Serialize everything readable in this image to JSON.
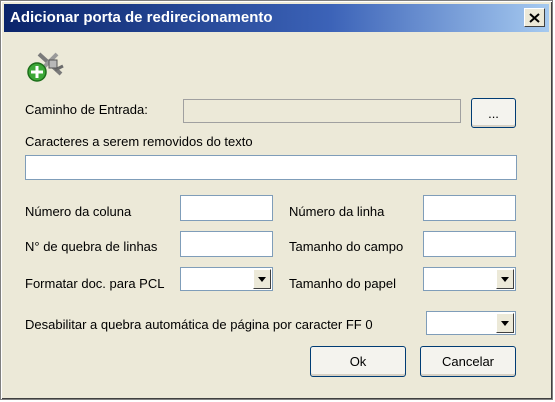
{
  "window": {
    "title": "Adicionar porta de redirecionamento",
    "close_icon": "close-icon"
  },
  "icons": {
    "app": "network-port-add-icon"
  },
  "form": {
    "input_path": {
      "label": "Caminho de Entrada:",
      "value": "",
      "browse_label": "..."
    },
    "chars_remove": {
      "label": "Caracteres a serem removidos do texto",
      "value": ""
    },
    "column_number": {
      "label": "Número da coluna",
      "value": ""
    },
    "line_number": {
      "label": "Número da linha",
      "value": ""
    },
    "line_break_count": {
      "label": "N° de quebra de linhas",
      "value": ""
    },
    "field_size": {
      "label": "Tamanho do campo",
      "value": ""
    },
    "format_pcl": {
      "label": "Formatar doc. para PCL",
      "value": ""
    },
    "paper_size": {
      "label": "Tamanho do papel",
      "value": ""
    },
    "disable_ff": {
      "label": "Desabilitar a quebra automática de página por caracter FF 0",
      "value": ""
    }
  },
  "buttons": {
    "ok": "Ok",
    "cancel": "Cancelar"
  },
  "colors": {
    "titlebar_start": "#0a246a",
    "titlebar_end": "#a6caf0",
    "dialog_bg": "#ece9d8"
  }
}
